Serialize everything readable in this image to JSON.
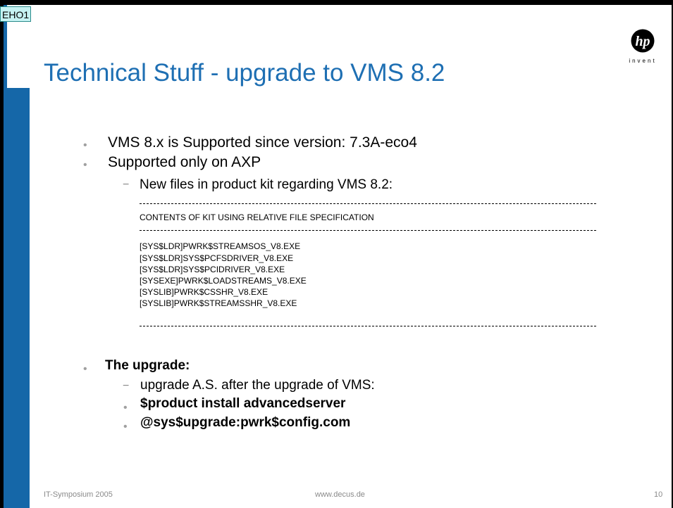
{
  "comment_tag": "EHO1",
  "logo": {
    "icon": "hp-logo-icon",
    "wordmark": "invent",
    "brand_color": "#1e6fb3"
  },
  "title": "Technical Stuff - upgrade to VMS 8.2",
  "bullets": {
    "b1": "VMS 8.x is Supported since version: 7.3A-eco4",
    "b2": "Supported only on AXP",
    "sub1": "New files in product kit regarding VMS 8.2:"
  },
  "kit_listing": {
    "header": "CONTENTS OF KIT USING RELATIVE FILE SPECIFICATION",
    "files": [
      "[SYS$LDR]PWRK$STREAMSOS_V8.EXE",
      "[SYS$LDR]SYS$PCFSDRIVER_V8.EXE",
      "[SYS$LDR]SYS$PCIDRIVER_V8.EXE",
      "[SYSEXE]PWRK$LOADSTREAMS_V8.EXE",
      "[SYSLIB]PWRK$CSSHR_V8.EXE",
      "[SYSLIB]PWRK$STREAMSSHR_V8.EXE"
    ]
  },
  "upgrade": {
    "heading": "The upgrade:",
    "step": "upgrade A.S. after the upgrade of VMS:",
    "cmd1": "$product install advancedserver",
    "cmd2": "@sys$upgrade:pwrk$config.com"
  },
  "footer": {
    "left": "IT-Symposium 2005",
    "center": "www.decus.de",
    "page": "10"
  },
  "colors": {
    "accent": "#1567a8",
    "title": "#1e6fb3",
    "bullet": "#a0a0a0"
  }
}
